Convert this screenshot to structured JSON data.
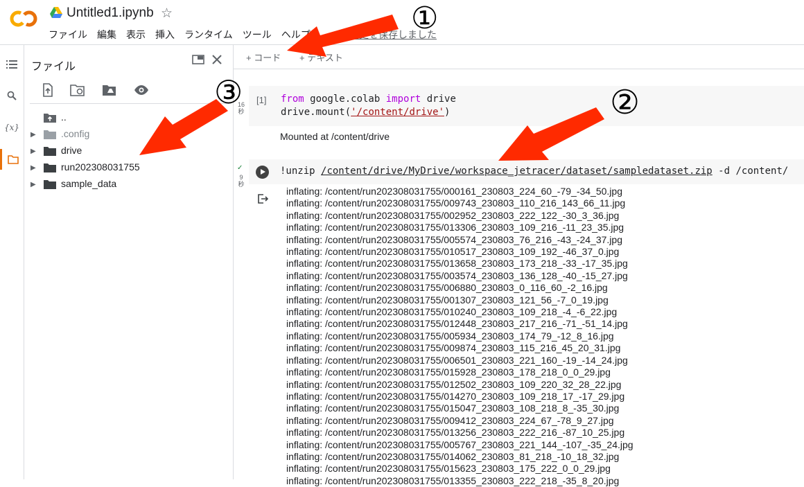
{
  "notebook": {
    "title": "Untitled1.ipynb",
    "save_status": "変更を保存しました",
    "menu": [
      "ファイル",
      "編集",
      "表示",
      "挿入",
      "ランタイム",
      "ツール",
      "ヘルプ"
    ]
  },
  "toolbar": {
    "add_code": "+ コード",
    "add_text": "+ テキスト"
  },
  "files_panel": {
    "title": "ファイル",
    "items": [
      {
        "label": "..",
        "type": "parent"
      },
      {
        "label": ".config",
        "type": "folder",
        "muted": true
      },
      {
        "label": "drive",
        "type": "folder"
      },
      {
        "label": "run202308031755",
        "type": "folder"
      },
      {
        "label": "sample_data",
        "type": "folder"
      }
    ]
  },
  "cells": {
    "cell1": {
      "exec_count": "[1]",
      "exec_time": "16\n秒",
      "line1": {
        "kw1": "from",
        "mod": " google.colab ",
        "kw2": "import",
        "name": " drive"
      },
      "line2": {
        "pre": "drive.mount(",
        "str": "'/content/drive'",
        "post": ")"
      },
      "output": "Mounted at /content/drive"
    },
    "cell2": {
      "exec_time": "9\n秒",
      "cmd_pre": "!unzip ",
      "cmd_path": "/content/drive/MyDrive/workspace_jetracer/dataset/sampledataset.zip",
      "cmd_post": " -d /content/",
      "output_lines": [
        "inflating: /content/run202308031755/000161_230803_224_60_-79_-34_50.jpg",
        "inflating: /content/run202308031755/009743_230803_110_216_143_66_11.jpg",
        "inflating: /content/run202308031755/002952_230803_222_122_-30_3_36.jpg",
        "inflating: /content/run202308031755/013306_230803_109_216_-11_23_35.jpg",
        "inflating: /content/run202308031755/005574_230803_76_216_-43_-24_37.jpg",
        "inflating: /content/run202308031755/010517_230803_109_192_-46_37_0.jpg",
        "inflating: /content/run202308031755/013658_230803_173_218_-33_-17_35.jpg",
        "inflating: /content/run202308031755/003574_230803_136_128_-40_-15_27.jpg",
        "inflating: /content/run202308031755/006880_230803_0_116_60_-2_16.jpg",
        "inflating: /content/run202308031755/001307_230803_121_56_-7_0_19.jpg",
        "inflating: /content/run202308031755/010240_230803_109_218_-4_-6_22.jpg",
        "inflating: /content/run202308031755/012448_230803_217_216_-71_-51_14.jpg",
        "inflating: /content/run202308031755/005934_230803_174_79_-12_8_16.jpg",
        "inflating: /content/run202308031755/009874_230803_115_216_45_20_31.jpg",
        "inflating: /content/run202308031755/006501_230803_221_160_-19_-14_24.jpg",
        "inflating: /content/run202308031755/015928_230803_178_218_0_0_29.jpg",
        "inflating: /content/run202308031755/012502_230803_109_220_32_28_22.jpg",
        "inflating: /content/run202308031755/014270_230803_109_218_17_-17_29.jpg",
        "inflating: /content/run202308031755/015047_230803_108_218_8_-35_30.jpg",
        "inflating: /content/run202308031755/009412_230803_224_67_-78_9_27.jpg",
        "inflating: /content/run202308031755/013256_230803_222_216_-87_10_25.jpg",
        "inflating: /content/run202308031755/005767_230803_221_144_-107_-35_24.jpg",
        "inflating: /content/run202308031755/014062_230803_81_218_-10_18_32.jpg",
        "inflating: /content/run202308031755/015623_230803_175_222_0_0_29.jpg",
        "inflating: /content/run202308031755/013355_230803_222_218_-35_8_20.jpg"
      ]
    }
  },
  "annotations": {
    "n1": "①",
    "n2": "②",
    "n3": "③",
    "arrow_color": "#ff2a00"
  }
}
